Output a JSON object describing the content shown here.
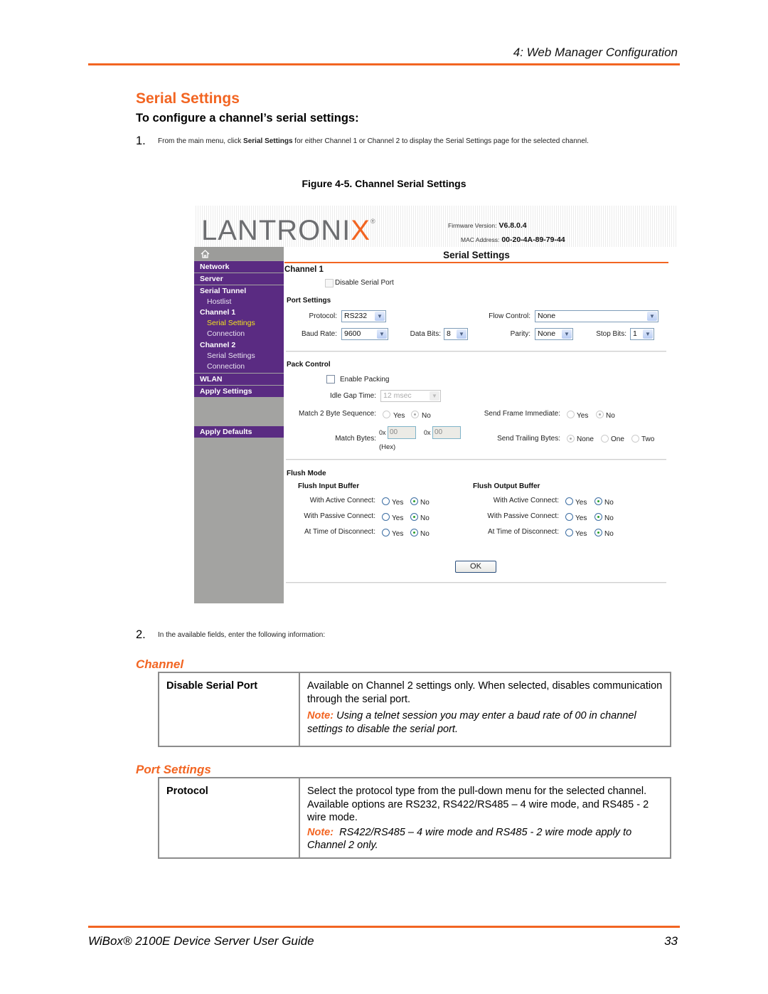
{
  "page": {
    "running_head": "4: Web Manager Configuration",
    "section_title": "Serial Settings",
    "procedure_title": "To configure a channel’s serial settings:",
    "steps": [
      {
        "num": "1.",
        "pre": "From the main menu, click ",
        "bold": "Serial Settings",
        "post": " for either Channel 1 or Channel 2 to display the Serial Settings page for the selected channel."
      },
      {
        "num": "2.",
        "text": "In the available fields, enter the following information:"
      }
    ],
    "figure_caption": "Figure 4-5. Channel Serial Settings",
    "footer_title": "WiBox® 2100E Device Server User Guide",
    "page_number": "33",
    "accent_color": "#f26522"
  },
  "screenshot": {
    "logo": {
      "text_main": "LANTRONI",
      "text_x": "X",
      "reg": "®"
    },
    "firmware_label": "Firmware Version:",
    "firmware_value": "V6.8.0.4",
    "mac_label": "MAC Address:",
    "mac_value": "00-20-4A-89-79-44",
    "sidebar": {
      "home_icon": "home-icon",
      "items": [
        {
          "label": "Network",
          "type": "bold"
        },
        {
          "label": "Server",
          "type": "bold"
        },
        {
          "label": "Serial Tunnel",
          "type": "bold"
        },
        {
          "label": "Hostlist",
          "type": "sub"
        },
        {
          "label": "Channel 1",
          "type": "bold"
        },
        {
          "label": "Serial Settings",
          "type": "sub",
          "active": true
        },
        {
          "label": "Connection",
          "type": "sub"
        },
        {
          "label": "Channel 2",
          "type": "bold"
        },
        {
          "label": "Serial Settings",
          "type": "sub"
        },
        {
          "label": "Connection",
          "type": "sub"
        },
        {
          "label": "WLAN",
          "type": "bold"
        },
        {
          "label": "Apply Settings",
          "type": "bold"
        },
        {
          "label": "Apply Defaults",
          "type": "bold"
        }
      ],
      "colors": {
        "purple": "#5a2b82",
        "gray": "#a3a3a1",
        "active": "#f2e21e"
      }
    },
    "page_title": "Serial Settings",
    "channel_title": "Channel 1",
    "disable_serial_port": {
      "label": "Disable Serial Port",
      "checked": false
    },
    "port_settings": {
      "heading": "Port Settings",
      "protocol": {
        "label": "Protocol:",
        "value": "RS232"
      },
      "flow_control": {
        "label": "Flow Control:",
        "value": "None"
      },
      "baud_rate": {
        "label": "Baud Rate:",
        "value": "9600"
      },
      "data_bits": {
        "label": "Data Bits:",
        "value": "8"
      },
      "parity": {
        "label": "Parity:",
        "value": "None"
      },
      "stop_bits": {
        "label": "Stop Bits:",
        "value": "1"
      }
    },
    "pack_control": {
      "heading": "Pack Control",
      "enable_packing": {
        "label": "Enable Packing",
        "checked": false
      },
      "idle_gap": {
        "label": "Idle Gap Time:",
        "value": "12 msec"
      },
      "match_2byte": {
        "label": "Match 2 Byte Sequence:",
        "yes": "Yes",
        "no": "No",
        "selected": "No"
      },
      "send_frame": {
        "label": "Send Frame Immediate:",
        "yes": "Yes",
        "no": "No",
        "selected": "No"
      },
      "match_bytes": {
        "label": "Match Bytes:",
        "prefix": "0x",
        "value1": "00",
        "value2": "00",
        "hex_note": "(Hex)"
      },
      "trailing": {
        "label": "Send Trailing Bytes:",
        "options": [
          "None",
          "One",
          "Two"
        ],
        "selected": "None"
      }
    },
    "flush_mode": {
      "heading": "Flush Mode",
      "input": {
        "heading": "Flush Input Buffer",
        "rows": [
          {
            "label": "With Active Connect:",
            "selected": "No"
          },
          {
            "label": "With Passive Connect:",
            "selected": "No"
          },
          {
            "label": "At Time of Disconnect:",
            "selected": "No"
          }
        ]
      },
      "output": {
        "heading": "Flush Output Buffer",
        "rows": [
          {
            "label": "With Active Connect:",
            "selected": "No"
          },
          {
            "label": "With Passive Connect:",
            "selected": "No"
          },
          {
            "label": "At Time of Disconnect:",
            "selected": "No"
          }
        ]
      },
      "yes": "Yes",
      "no": "No"
    },
    "ok_label": "OK"
  },
  "tables": [
    {
      "heading": "Channel",
      "rows": [
        {
          "field": "Disable Serial Port",
          "description": "Available on Channel 2 settings only. When selected, disables communication through the serial port.",
          "note_label": "Note:",
          "note": " Using a telnet session you may enter a baud rate of 00 in channel settings to disable the serial port."
        }
      ]
    },
    {
      "heading": "Port Settings",
      "rows": [
        {
          "field": "Protocol",
          "description": "Select the protocol type from the pull-down menu for the selected channel. Available options are RS232, RS422/RS485 – 4 wire mode, and RS485 - 2 wire mode.",
          "note_label": "Note:",
          "note": "  RS422/RS485 – 4 wire mode and RS485 - 2 wire mode apply to Channel 2 only."
        }
      ]
    }
  ]
}
